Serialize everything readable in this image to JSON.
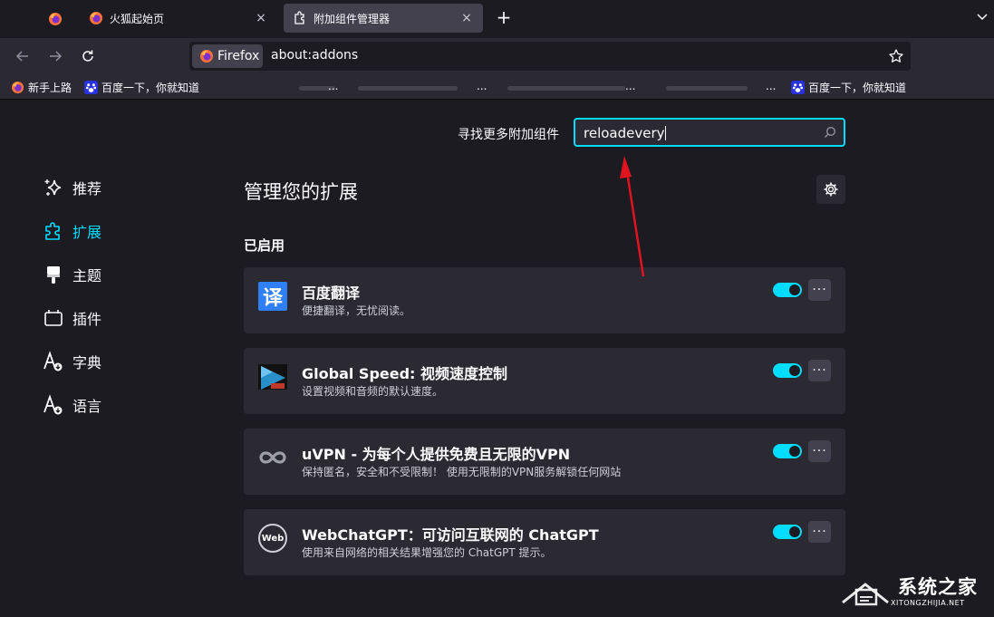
{
  "tabs": [
    {
      "label": "火狐起始页",
      "close": "×"
    },
    {
      "label": "附加组件管理器",
      "close": "×"
    }
  ],
  "newtab": "+",
  "identity_label": "Firefox",
  "url": "about:addons",
  "bookmarks": {
    "item1": "新手上路",
    "item2": "百度一下，你就知道",
    "dots": [
      "...",
      "...",
      "...",
      "..."
    ],
    "item3": "百度一下，你就知道"
  },
  "search": {
    "label": "寻找更多附加组件",
    "value": "reloadevery"
  },
  "categories": [
    "推荐",
    "扩展",
    "主题",
    "插件",
    "字典",
    "语言"
  ],
  "page_title": "管理您的扩展",
  "section": "已启用",
  "extensions": [
    {
      "name": "百度翻译",
      "desc": "便捷翻译，无忧阅读。",
      "logo_char": "译"
    },
    {
      "name": "Global Speed: 视频速度控制",
      "desc": "设置视频和音频的默认速度。"
    },
    {
      "name": "uVPN - 为每个人提供免费且无限的VPN",
      "desc": "保持匿名，安全和不受限制！ 使用无限制的VPN服务解锁任何网站"
    },
    {
      "name": "WebChatGPT：可访问互联网的 ChatGPT",
      "desc": "使用来自网络的相关结果增强您的 ChatGPT 提示。",
      "logo_text": "Web"
    }
  ],
  "more_label": "···",
  "watermark": {
    "title": "系统之家",
    "sub": "XITONGZHIJIA.NET"
  },
  "colors": {
    "accent": "#00ddff",
    "bg": "#1c1b22",
    "card": "#2b2a33",
    "arrow": "#e0141e"
  }
}
